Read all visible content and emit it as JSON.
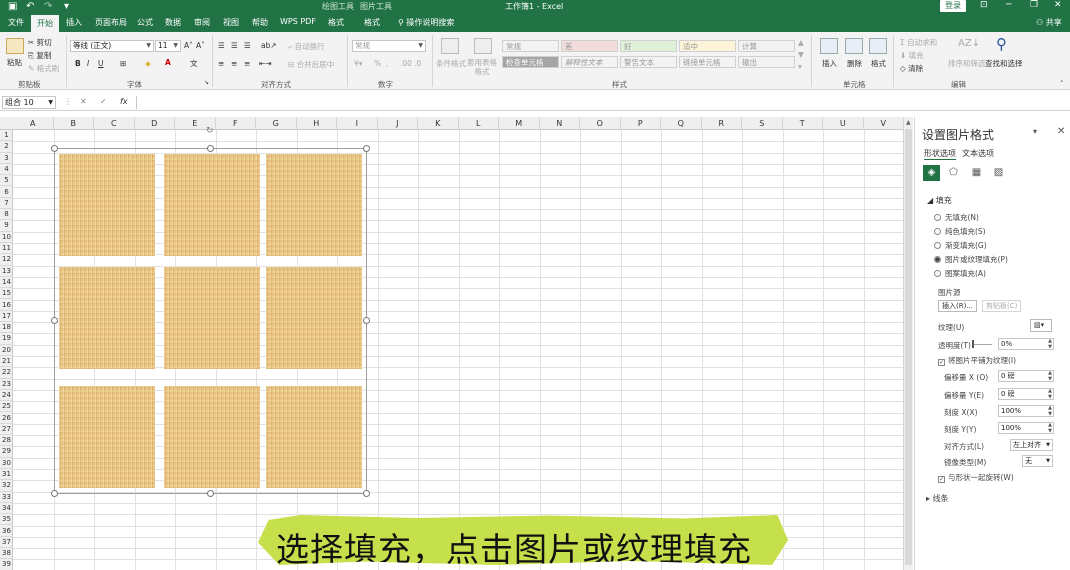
{
  "window": {
    "title": "工作簿1 - Excel",
    "context_tabs": [
      "绘图工具",
      "图片工具"
    ],
    "login": "登录",
    "share": "共享"
  },
  "tabs": [
    {
      "label": "文件"
    },
    {
      "label": "开始"
    },
    {
      "label": "插入"
    },
    {
      "label": "页面布局"
    },
    {
      "label": "公式"
    },
    {
      "label": "数据"
    },
    {
      "label": "审阅"
    },
    {
      "label": "视图"
    },
    {
      "label": "帮助"
    },
    {
      "label": "WPS PDF"
    },
    {
      "label": "格式"
    },
    {
      "label": "格式"
    }
  ],
  "tell_me": "操作说明搜索",
  "ribbon": {
    "clipboard": {
      "paste": "粘贴",
      "cut": "剪切",
      "copy": "复制",
      "format_painter": "格式刷",
      "label": "剪贴板"
    },
    "font": {
      "name": "等线 (正文)",
      "size": "11",
      "bold": "B",
      "italic": "I",
      "underline": "U",
      "label": "字体"
    },
    "alignment": {
      "wrap": "自动换行",
      "merge": "合并后居中",
      "label": "对齐方式"
    },
    "number": {
      "format": "常规",
      "label": "数字"
    },
    "styles": {
      "conditional": "条件格式",
      "table": "套用表格格式",
      "cells": [
        "常规",
        "差",
        "好",
        "适中",
        "计算",
        "检查单元格",
        "解释性文本",
        "警告文本",
        "链接单元格",
        "输出"
      ],
      "label": "样式"
    },
    "cells": {
      "insert": "插入",
      "delete": "删除",
      "format": "格式",
      "label": "单元格"
    },
    "editing": {
      "autosum": "自动求和",
      "fill": "填充",
      "clear": "清除",
      "sort": "排序和筛选",
      "find": "查找和选择",
      "label": "编辑"
    }
  },
  "formula_bar": {
    "name_box": "组合 10",
    "cancel": "✕",
    "enter": "✓",
    "fx": "fx"
  },
  "columns": [
    "A",
    "B",
    "C",
    "D",
    "E",
    "F",
    "G",
    "H",
    "I",
    "J",
    "K",
    "L",
    "M",
    "N",
    "O",
    "P",
    "Q",
    "R",
    "S",
    "T",
    "U",
    "V"
  ],
  "rows": [
    "1",
    "2",
    "3",
    "4",
    "5",
    "6",
    "7",
    "8",
    "9",
    "10",
    "11",
    "12",
    "13",
    "14",
    "15",
    "16",
    "17",
    "18",
    "19",
    "20",
    "21",
    "22",
    "23",
    "24",
    "25",
    "26",
    "27",
    "28",
    "29",
    "30",
    "31",
    "32",
    "33",
    "34",
    "35",
    "36",
    "37",
    "38",
    "39"
  ],
  "pane": {
    "title": "设置图片格式",
    "tab_shape": "形状选项",
    "tab_text": "文本选项",
    "fill_section": "填充",
    "fill_options": [
      "无填充(N)",
      "纯色填充(S)",
      "渐变填充(G)",
      "图片或纹理填充(P)",
      "图案填充(A)"
    ],
    "selected_fill": 3,
    "picture_source": "图片源",
    "insert_btn": "插入(R)...",
    "clipboard_btn": "剪贴板(C)",
    "texture": "纹理(U)",
    "transparency": {
      "label": "透明度(T)",
      "value": "0%"
    },
    "tile_checkbox": "将图片平铺为纹理(I)",
    "offset_x": {
      "label": "偏移量 X (O)",
      "value": "0 磅"
    },
    "offset_y": {
      "label": "偏移量 Y(E)",
      "value": "0 磅"
    },
    "scale_x": {
      "label": "刻度 X(X)",
      "value": "100%"
    },
    "scale_y": {
      "label": "刻度 Y(Y)",
      "value": "100%"
    },
    "alignment": {
      "label": "对齐方式(L)",
      "value": "左上对齐"
    },
    "mirror": {
      "label": "镜像类型(M)",
      "value": "无"
    },
    "rotate_checkbox": "与形状一起旋转(W)",
    "line_section": "线条"
  },
  "subtitle": "选择填充，点击图片或纹理填充"
}
